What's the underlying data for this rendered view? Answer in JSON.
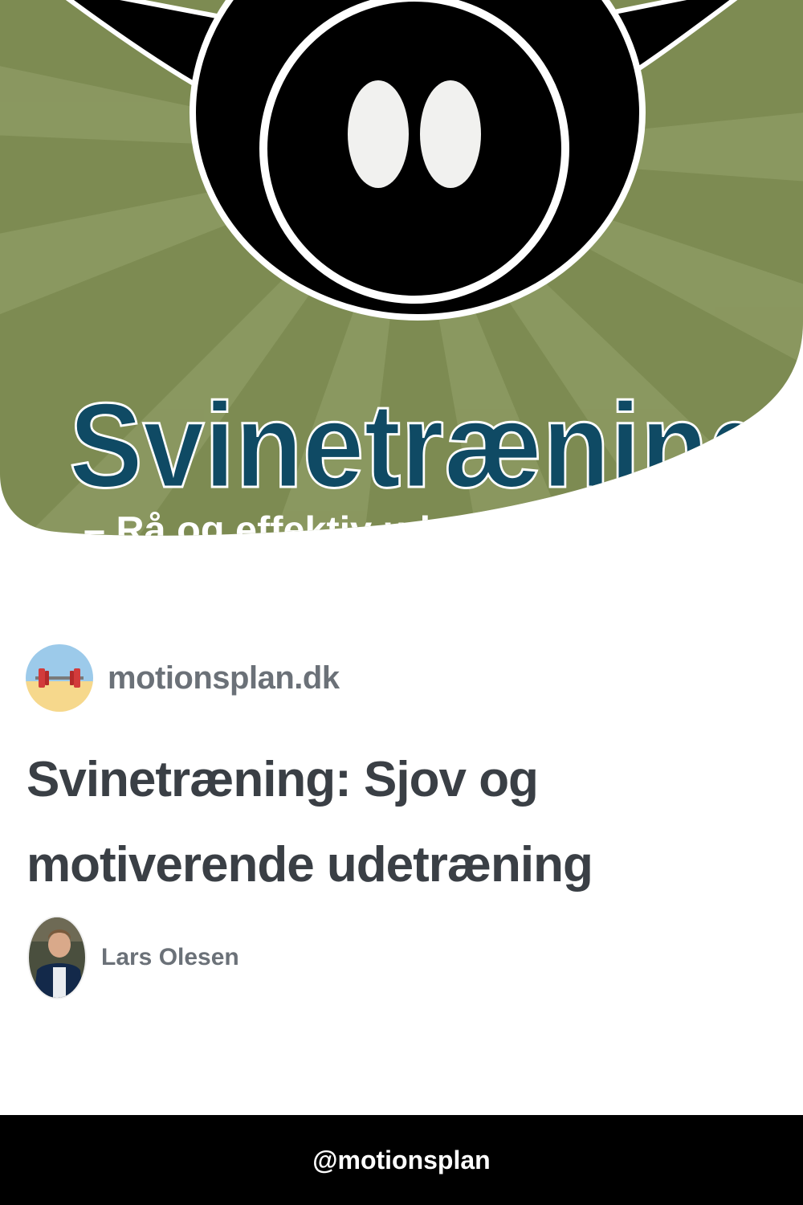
{
  "hero": {
    "cover_title": "Svinetræning",
    "cover_subtitle": "– Rå og effektiv udetræning",
    "colors": {
      "background": "#7d8b52",
      "title": "#0f4a64"
    }
  },
  "site": {
    "name": "motionsplan.dk",
    "icon": "barbell-icon"
  },
  "article": {
    "title": "Svinetræning: Sjov og motiverende udetræning"
  },
  "author": {
    "name": "Lars Olesen"
  },
  "footer": {
    "handle": "@motionsplan"
  }
}
